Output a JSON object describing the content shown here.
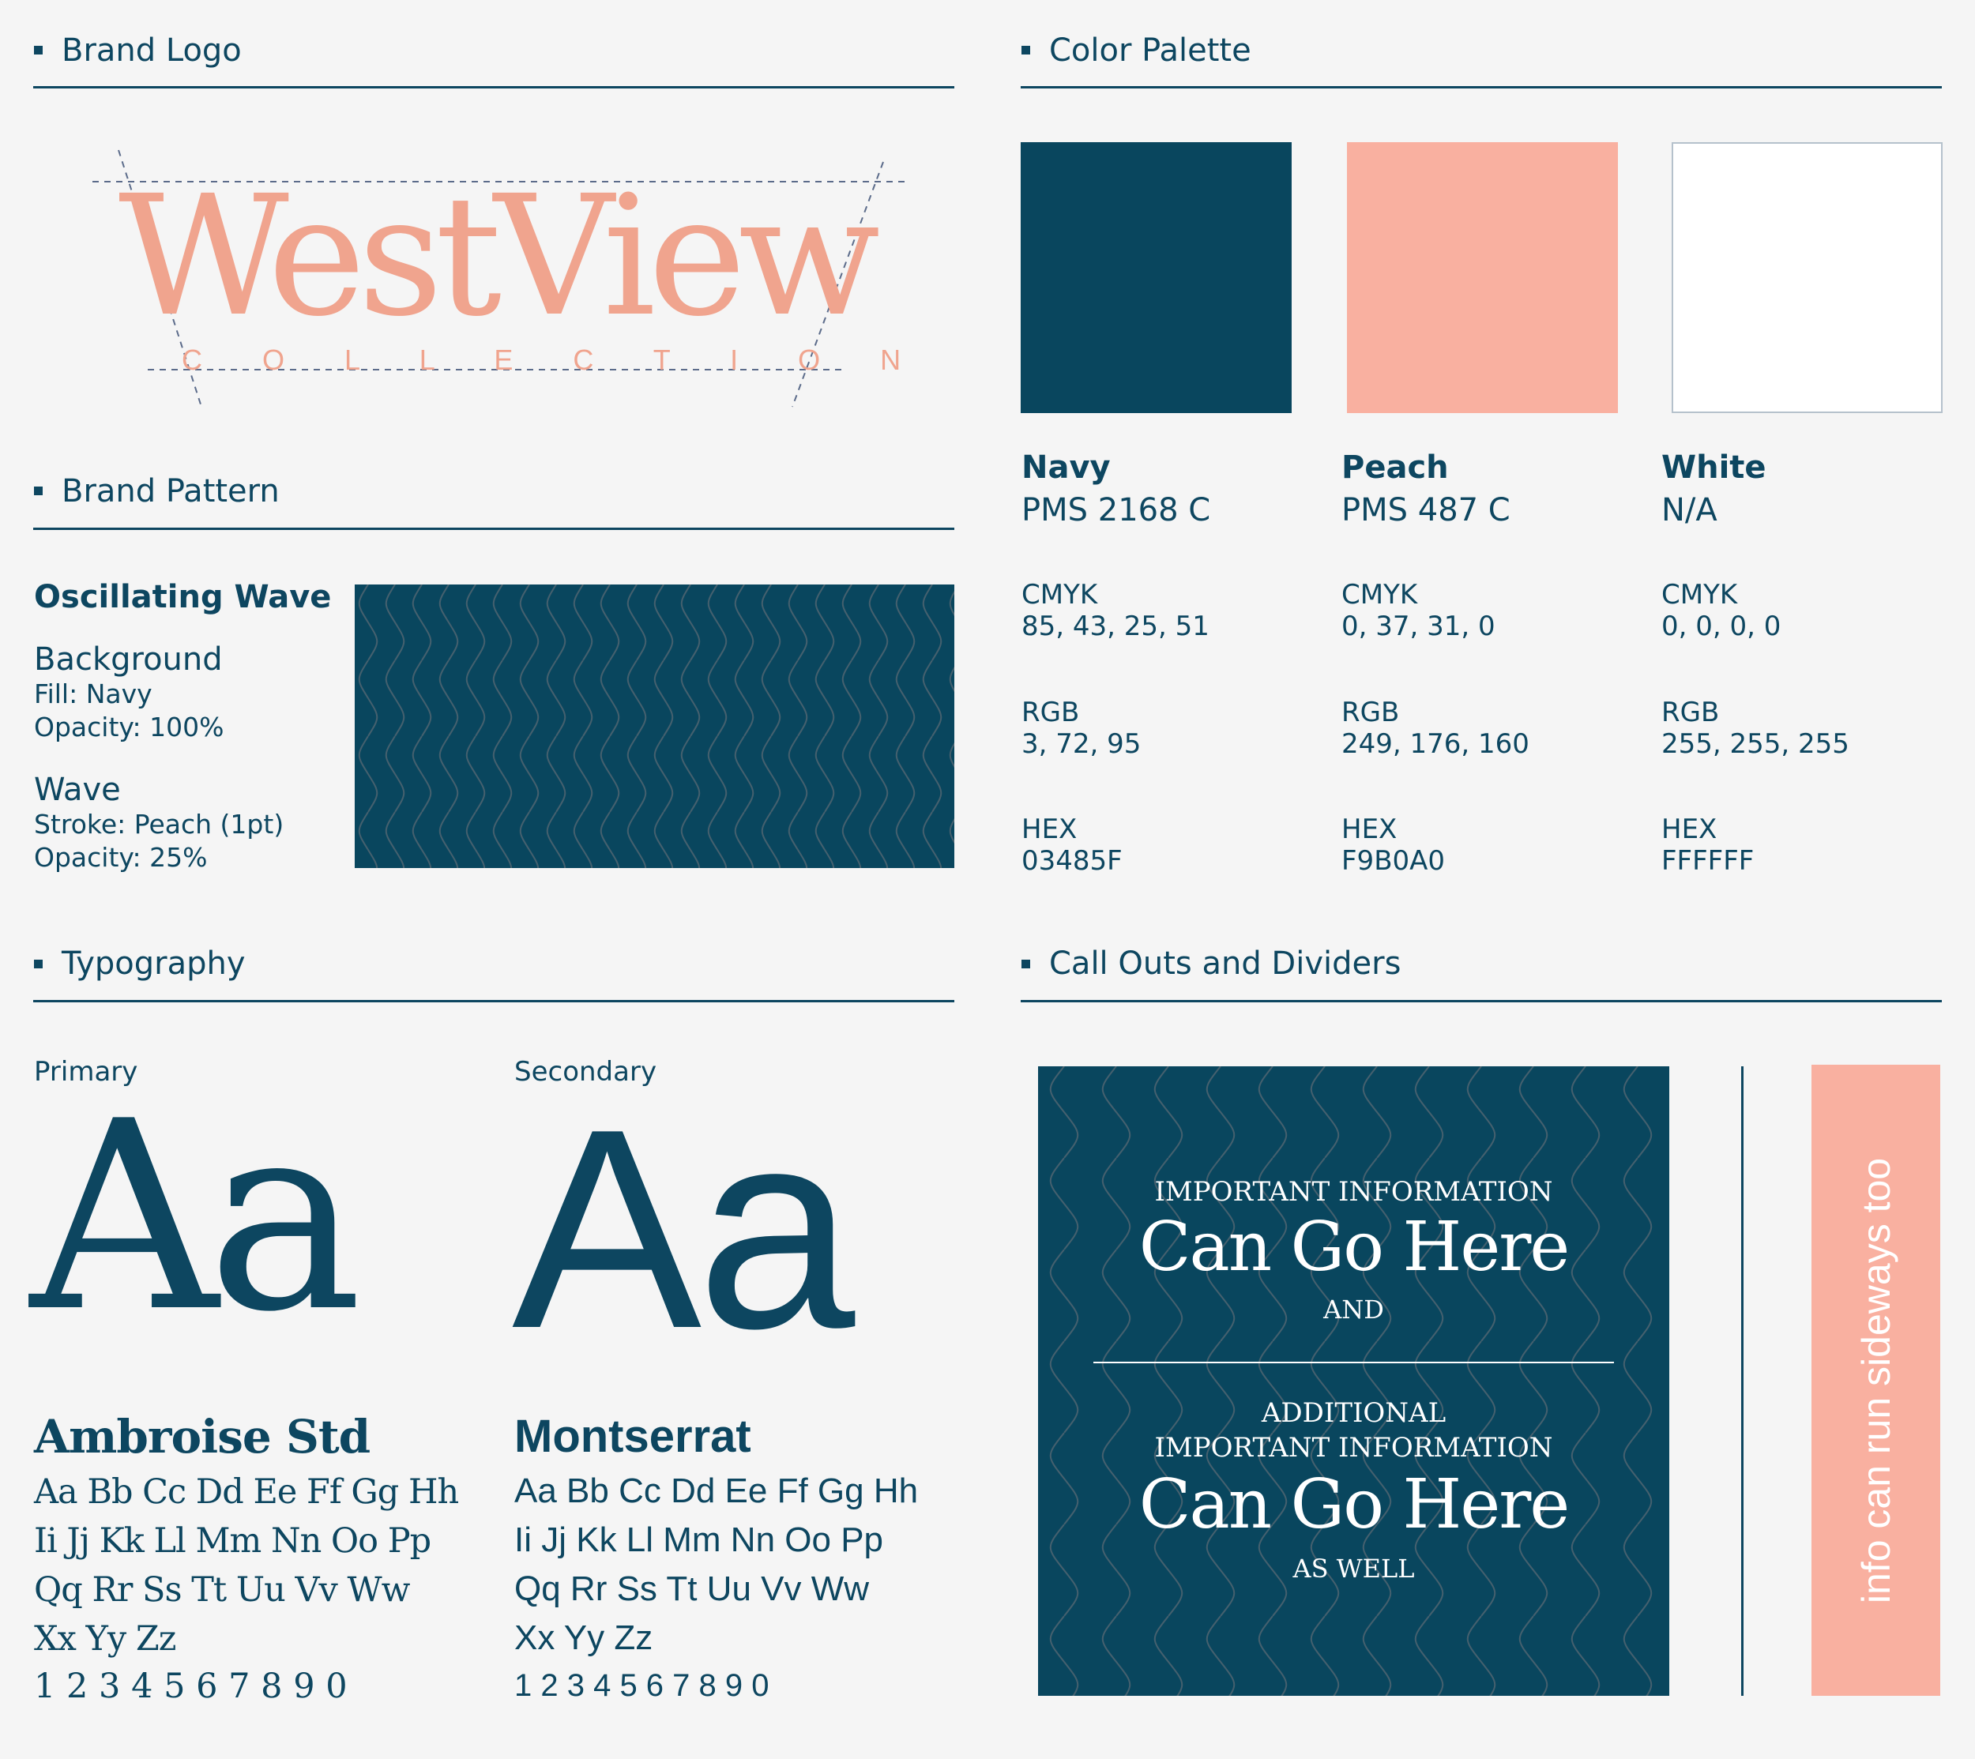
{
  "sections": {
    "brand_logo": "Brand Logo",
    "color_palette": "Color Palette",
    "brand_pattern": "Brand Pattern",
    "typography": "Typography",
    "callouts": "Call Outs and Dividers"
  },
  "logo": {
    "wordmark": "WestView",
    "subline": "C O L L E C T I O N",
    "color": "#f0a48e"
  },
  "palette": [
    {
      "name": "Navy",
      "pms": "PMS 2168 C",
      "cmyk_label": "CMYK",
      "cmyk": "85, 43, 25, 51",
      "rgb_label": "RGB",
      "rgb": "3, 72, 95",
      "hex_label": "HEX",
      "hex": "03485F",
      "color": "#09465e"
    },
    {
      "name": "Peach",
      "pms": "PMS 487 C",
      "cmyk_label": "CMYK",
      "cmyk": "0, 37, 31, 0",
      "rgb_label": "RGB",
      "rgb": "249, 176, 160",
      "hex_label": "HEX",
      "hex": "F9B0A0",
      "color": "#f9b0a0"
    },
    {
      "name": "White",
      "pms": "N/A",
      "cmyk_label": "CMYK",
      "cmyk": "0, 0, 0, 0",
      "rgb_label": "RGB",
      "rgb": "255, 255, 255",
      "hex_label": "HEX",
      "hex": "FFFFFF",
      "color": "#ffffff"
    }
  ],
  "pattern": {
    "name": "Oscillating Wave",
    "background_title": "Background",
    "background_fill": "Fill: Navy",
    "background_opacity": "Opacity: 100%",
    "wave_title": "Wave",
    "wave_stroke": "Stroke: Peach (1pt)",
    "wave_opacity": "Opacity: 25%"
  },
  "typography": {
    "primary_label": "Primary",
    "secondary_label": "Secondary",
    "sample": "Aa",
    "primary_name": "Ambroise Std",
    "secondary_name": "Montserrat",
    "rows": [
      "Aa Bb Cc Dd Ee Ff Gg Hh",
      "Ii Jj Kk Ll Mm Nn Oo Pp",
      "Qq Rr Ss Tt Uu Vv Ww",
      "Xx Yy Zz",
      "1 2 3 4 5 6 7 8 9 0"
    ],
    "secondary_digits": "1 2 3 4 5 6 7 8 9 0"
  },
  "callout": {
    "line1": "IMPORTANT INFORMATION",
    "big1": "Can Go Here",
    "and": "AND",
    "line2": "ADDITIONAL",
    "line3": "IMPORTANT INFORMATION",
    "big2": "Can Go Here",
    "as_well": "AS WELL",
    "sideways": "info can run sideways too"
  }
}
